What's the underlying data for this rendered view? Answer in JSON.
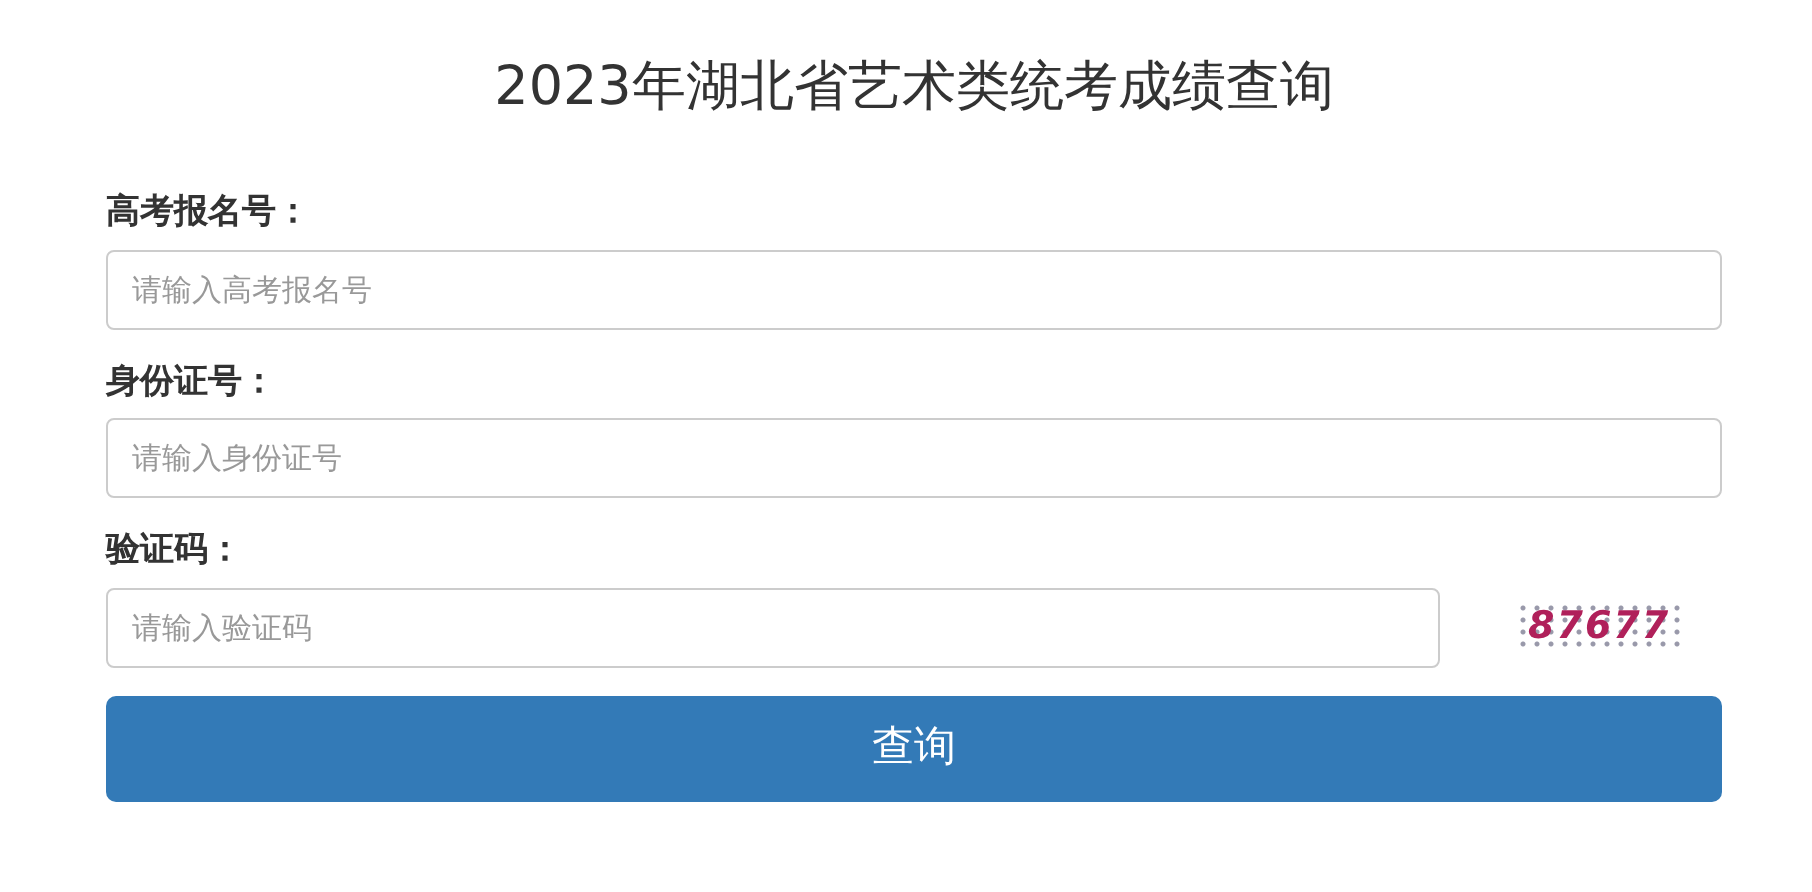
{
  "title": "2023年湖北省艺术类统考成绩查询",
  "fields": [
    {
      "label": "高考报名号：",
      "placeholder": "请输入高考报名号"
    },
    {
      "label": "身份证号：",
      "placeholder": "请输入身份证号"
    },
    {
      "label": "验证码：",
      "placeholder": "请输入验证码",
      "captcha": "87677"
    }
  ],
  "submit": "查询"
}
